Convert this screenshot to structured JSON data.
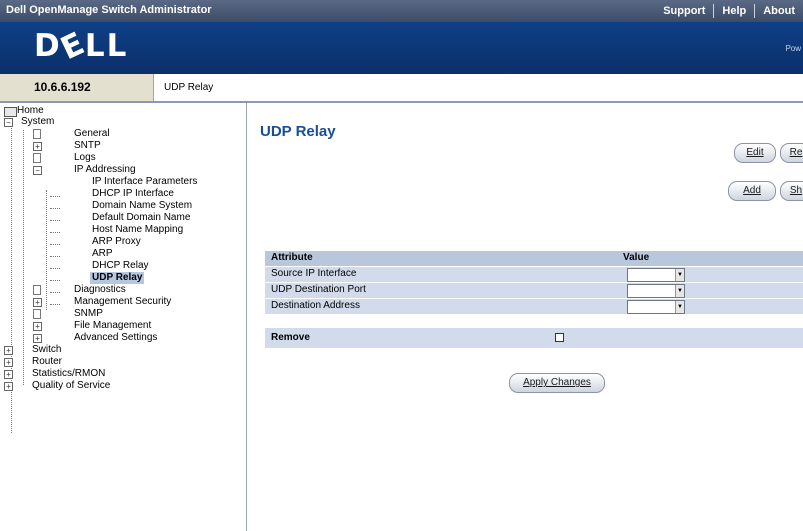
{
  "app": {
    "title": "Dell OpenManage Switch Administrator",
    "links": [
      "Support",
      "Help",
      "About"
    ],
    "brand_logo": "DELL",
    "brand_right": "Pow"
  },
  "pathbar": {
    "ip": "10.6.6.192",
    "breadcrumb": "UDP Relay"
  },
  "tree": {
    "home": "Home",
    "system": "System",
    "general": "General",
    "snmp": "SNTP",
    "logs": "Logs",
    "ip_addressing": "IP Addressing",
    "ip_interface_parameters": "IP Interface Parameters",
    "dhcp_ip_interface": "DHCP IP Interface",
    "domain_name_system": "Domain Name System",
    "default_domain_name": "Default Domain Name",
    "host_name_mapping": "Host Name Mapping",
    "arp_proxy": "ARP Proxy",
    "arp": "ARP",
    "dhcp_relay": "DHCP Relay",
    "udp_relay": "UDP Relay",
    "diagnostics": "Diagnostics",
    "management_security": "Management Security",
    "snmp2": "SNMP",
    "file_management": "File Management",
    "advanced_settings": "Advanced Settings",
    "switch": "Switch",
    "router": "Router",
    "statistics_rmon": "Statistics/RMON",
    "quality_of_service": "Quality of Service"
  },
  "main": {
    "title": "UDP Relay",
    "buttons": {
      "edit": "Edit",
      "refresh": "Re",
      "add": "Add",
      "show_all": "Sh"
    },
    "table": {
      "col_attribute": "Attribute",
      "col_value": "Value",
      "rows": [
        {
          "label": "Source IP Interface",
          "value": ""
        },
        {
          "label": "UDP Destination Port",
          "value": ""
        },
        {
          "label": "Destination Address",
          "value": ""
        }
      ]
    },
    "remove_label": "Remove",
    "apply_label": "Apply Changes"
  },
  "colors": {
    "title_blue": "#174e96",
    "brand_blue": "#0f3f86",
    "row_bg": "#d1dbeb",
    "head_bg": "#b9c7dd"
  }
}
